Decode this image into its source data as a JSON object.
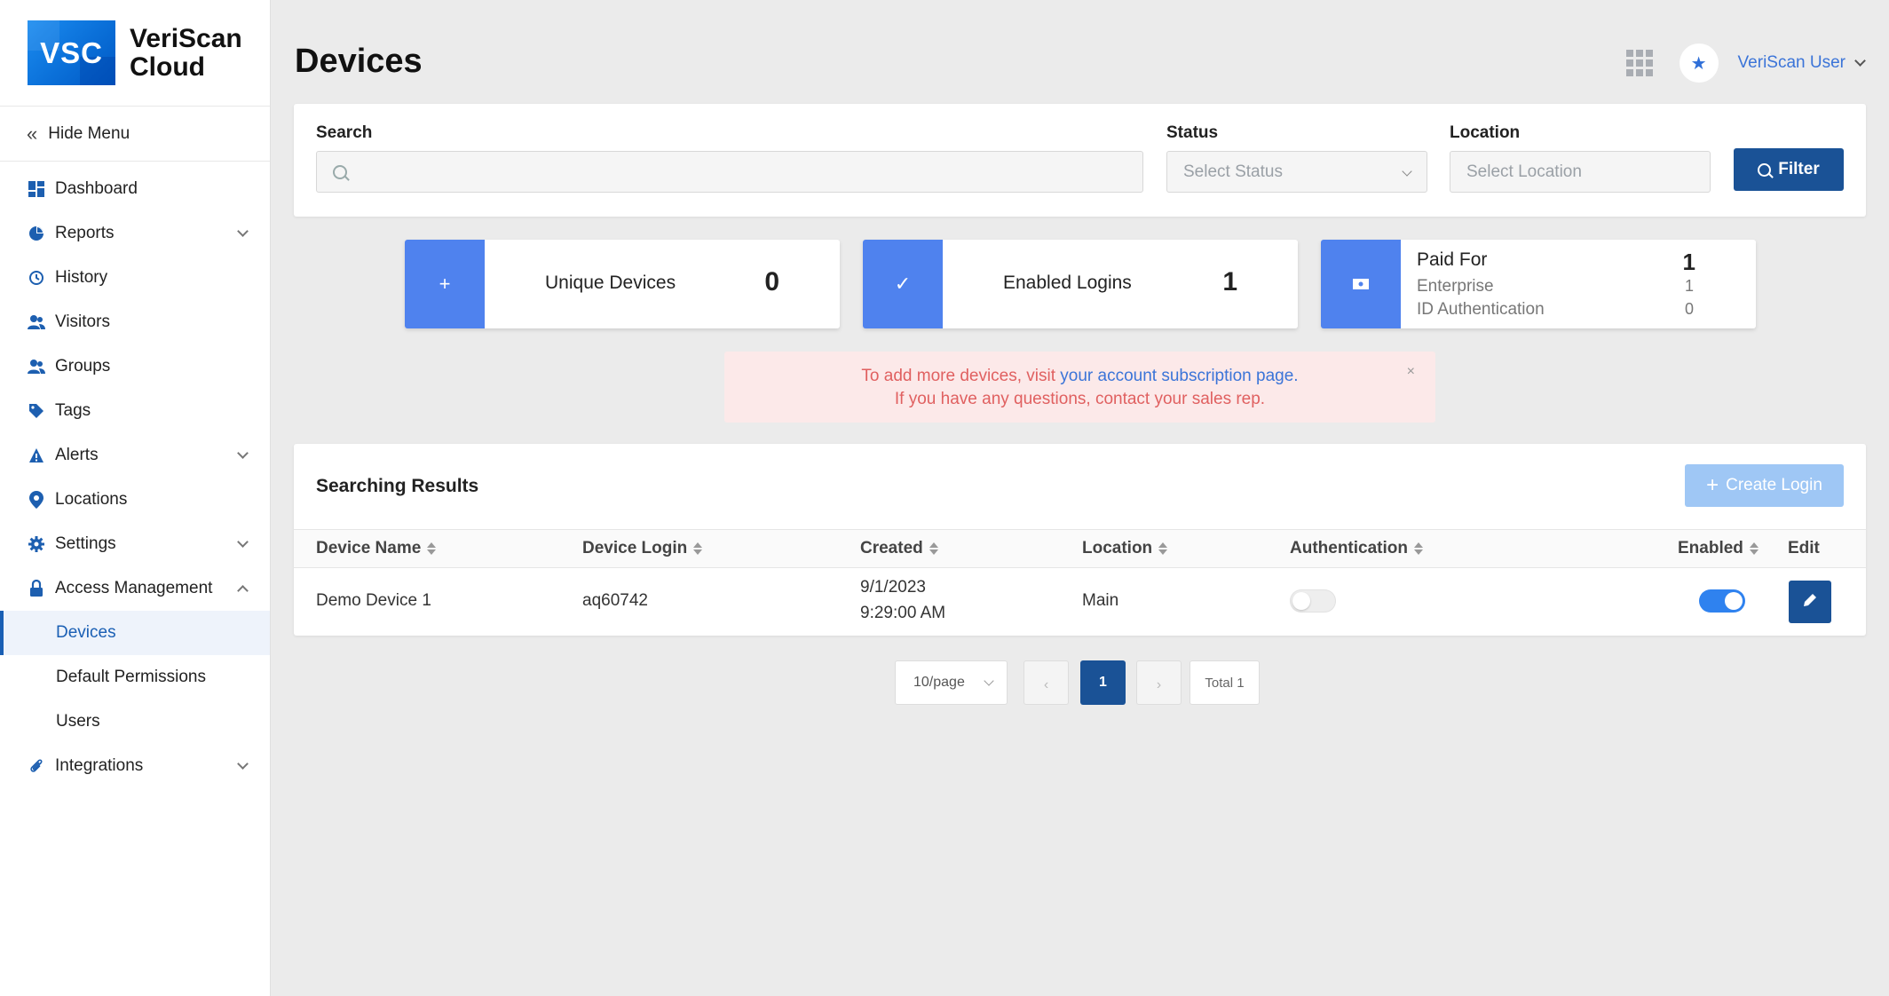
{
  "brand": {
    "logo_text": "VSC",
    "name_line1": "VeriScan",
    "name_line2": "Cloud"
  },
  "sidebar": {
    "hide_menu": "Hide Menu",
    "items": [
      {
        "label": "Dashboard",
        "icon": "dashboard-icon"
      },
      {
        "label": "Reports",
        "icon": "pie-chart-icon"
      },
      {
        "label": "History",
        "icon": "history-icon"
      },
      {
        "label": "Visitors",
        "icon": "users-icon"
      },
      {
        "label": "Groups",
        "icon": "group-icon"
      },
      {
        "label": "Tags",
        "icon": "tag-icon"
      },
      {
        "label": "Alerts",
        "icon": "warning-icon"
      },
      {
        "label": "Locations",
        "icon": "location-pin-icon"
      },
      {
        "label": "Settings",
        "icon": "gear-icon"
      },
      {
        "label": "Access Management",
        "icon": "lock-icon"
      },
      {
        "label": "Integrations",
        "icon": "paperclip-icon"
      }
    ],
    "sub_items": [
      "Devices",
      "Default Permissions",
      "Users"
    ]
  },
  "header": {
    "title": "Devices",
    "user": "VeriScan User"
  },
  "filters": {
    "search_label": "Search",
    "status_label": "Status",
    "status_placeholder": "Select Status",
    "location_label": "Location",
    "location_placeholder": "Select Location",
    "filter_button": "Filter"
  },
  "stats": {
    "unique_devices": {
      "label": "Unique Devices",
      "value": "0",
      "icon": "+"
    },
    "enabled_logins": {
      "label": "Enabled Logins",
      "value": "1",
      "icon": "✓"
    },
    "paid_for": {
      "title": "Paid For",
      "total": "1",
      "rows": [
        {
          "label": "Enterprise",
          "value": "1"
        },
        {
          "label": "ID Authentication",
          "value": "0"
        }
      ]
    }
  },
  "alert": {
    "line1_prefix": "To add more devices, visit ",
    "line1_link": "your account subscription page.",
    "line2": "If you have any questions, contact your sales rep.",
    "close": "×"
  },
  "results": {
    "title": "Searching Results",
    "create_button": "Create Login",
    "columns": [
      "Device Name",
      "Device Login",
      "Created",
      "Location",
      "Authentication",
      "Enabled",
      "Edit"
    ],
    "rows": [
      {
        "device_name": "Demo Device 1",
        "device_login": "aq60742",
        "created_date": "9/1/2023",
        "created_time": "9:29:00 AM",
        "location": "Main",
        "authentication": false,
        "enabled": true
      }
    ]
  },
  "pagination": {
    "page_size": "10/page",
    "current_page": "1",
    "total": "Total 1",
    "prev": "‹",
    "next": "›"
  },
  "colors": {
    "primary": "#1a5296",
    "accent": "#4f82ee",
    "link": "#3b74d8",
    "alert_bg": "#fce9e9",
    "alert_text": "#e06060"
  }
}
